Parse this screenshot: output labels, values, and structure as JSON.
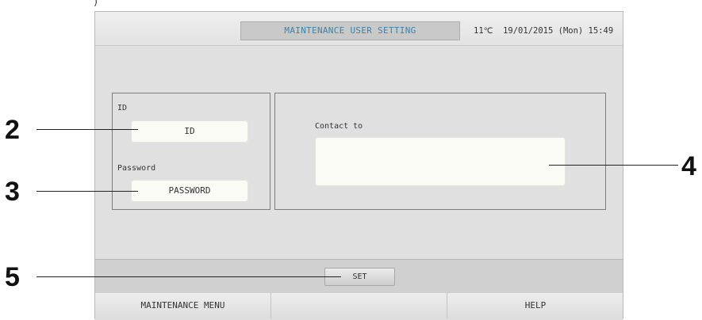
{
  "header_fragment": ")",
  "window": {
    "title": "MAINTENANCE USER SETTING",
    "status": {
      "temperature": "11℃",
      "datetime": "19/01/2015 (Mon) 15:49"
    }
  },
  "form": {
    "id_label": "ID",
    "id_value": "ID",
    "password_label": "Password",
    "password_value": "PASSWORD",
    "contact_label": "Contact to",
    "contact_value": ""
  },
  "actions": {
    "set_label": "SET"
  },
  "footer": {
    "left_label": "MAINTENANCE MENU",
    "middle_label": "",
    "right_label": "HELP"
  },
  "callouts": {
    "id": "2",
    "password": "3",
    "contact": "4",
    "set": "5"
  },
  "colors": {
    "title_text": "#3f83a8",
    "screen_background": "#e0e0e0",
    "field_background": "#fbfbf6"
  }
}
